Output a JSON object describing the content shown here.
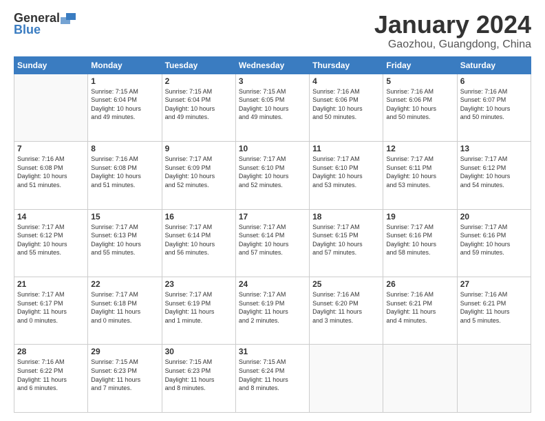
{
  "header": {
    "logo_general": "General",
    "logo_blue": "Blue",
    "month_title": "January 2024",
    "location": "Gaozhou, Guangdong, China"
  },
  "weekdays": [
    "Sunday",
    "Monday",
    "Tuesday",
    "Wednesday",
    "Thursday",
    "Friday",
    "Saturday"
  ],
  "weeks": [
    [
      {
        "day": "",
        "info": ""
      },
      {
        "day": "1",
        "info": "Sunrise: 7:15 AM\nSunset: 6:04 PM\nDaylight: 10 hours\nand 49 minutes."
      },
      {
        "day": "2",
        "info": "Sunrise: 7:15 AM\nSunset: 6:04 PM\nDaylight: 10 hours\nand 49 minutes."
      },
      {
        "day": "3",
        "info": "Sunrise: 7:15 AM\nSunset: 6:05 PM\nDaylight: 10 hours\nand 49 minutes."
      },
      {
        "day": "4",
        "info": "Sunrise: 7:16 AM\nSunset: 6:06 PM\nDaylight: 10 hours\nand 50 minutes."
      },
      {
        "day": "5",
        "info": "Sunrise: 7:16 AM\nSunset: 6:06 PM\nDaylight: 10 hours\nand 50 minutes."
      },
      {
        "day": "6",
        "info": "Sunrise: 7:16 AM\nSunset: 6:07 PM\nDaylight: 10 hours\nand 50 minutes."
      }
    ],
    [
      {
        "day": "7",
        "info": "Sunrise: 7:16 AM\nSunset: 6:08 PM\nDaylight: 10 hours\nand 51 minutes."
      },
      {
        "day": "8",
        "info": "Sunrise: 7:16 AM\nSunset: 6:08 PM\nDaylight: 10 hours\nand 51 minutes."
      },
      {
        "day": "9",
        "info": "Sunrise: 7:17 AM\nSunset: 6:09 PM\nDaylight: 10 hours\nand 52 minutes."
      },
      {
        "day": "10",
        "info": "Sunrise: 7:17 AM\nSunset: 6:10 PM\nDaylight: 10 hours\nand 52 minutes."
      },
      {
        "day": "11",
        "info": "Sunrise: 7:17 AM\nSunset: 6:10 PM\nDaylight: 10 hours\nand 53 minutes."
      },
      {
        "day": "12",
        "info": "Sunrise: 7:17 AM\nSunset: 6:11 PM\nDaylight: 10 hours\nand 53 minutes."
      },
      {
        "day": "13",
        "info": "Sunrise: 7:17 AM\nSunset: 6:12 PM\nDaylight: 10 hours\nand 54 minutes."
      }
    ],
    [
      {
        "day": "14",
        "info": "Sunrise: 7:17 AM\nSunset: 6:12 PM\nDaylight: 10 hours\nand 55 minutes."
      },
      {
        "day": "15",
        "info": "Sunrise: 7:17 AM\nSunset: 6:13 PM\nDaylight: 10 hours\nand 55 minutes."
      },
      {
        "day": "16",
        "info": "Sunrise: 7:17 AM\nSunset: 6:14 PM\nDaylight: 10 hours\nand 56 minutes."
      },
      {
        "day": "17",
        "info": "Sunrise: 7:17 AM\nSunset: 6:14 PM\nDaylight: 10 hours\nand 57 minutes."
      },
      {
        "day": "18",
        "info": "Sunrise: 7:17 AM\nSunset: 6:15 PM\nDaylight: 10 hours\nand 57 minutes."
      },
      {
        "day": "19",
        "info": "Sunrise: 7:17 AM\nSunset: 6:16 PM\nDaylight: 10 hours\nand 58 minutes."
      },
      {
        "day": "20",
        "info": "Sunrise: 7:17 AM\nSunset: 6:16 PM\nDaylight: 10 hours\nand 59 minutes."
      }
    ],
    [
      {
        "day": "21",
        "info": "Sunrise: 7:17 AM\nSunset: 6:17 PM\nDaylight: 11 hours\nand 0 minutes."
      },
      {
        "day": "22",
        "info": "Sunrise: 7:17 AM\nSunset: 6:18 PM\nDaylight: 11 hours\nand 0 minutes."
      },
      {
        "day": "23",
        "info": "Sunrise: 7:17 AM\nSunset: 6:19 PM\nDaylight: 11 hours\nand 1 minute."
      },
      {
        "day": "24",
        "info": "Sunrise: 7:17 AM\nSunset: 6:19 PM\nDaylight: 11 hours\nand 2 minutes."
      },
      {
        "day": "25",
        "info": "Sunrise: 7:16 AM\nSunset: 6:20 PM\nDaylight: 11 hours\nand 3 minutes."
      },
      {
        "day": "26",
        "info": "Sunrise: 7:16 AM\nSunset: 6:21 PM\nDaylight: 11 hours\nand 4 minutes."
      },
      {
        "day": "27",
        "info": "Sunrise: 7:16 AM\nSunset: 6:21 PM\nDaylight: 11 hours\nand 5 minutes."
      }
    ],
    [
      {
        "day": "28",
        "info": "Sunrise: 7:16 AM\nSunset: 6:22 PM\nDaylight: 11 hours\nand 6 minutes."
      },
      {
        "day": "29",
        "info": "Sunrise: 7:15 AM\nSunset: 6:23 PM\nDaylight: 11 hours\nand 7 minutes."
      },
      {
        "day": "30",
        "info": "Sunrise: 7:15 AM\nSunset: 6:23 PM\nDaylight: 11 hours\nand 8 minutes."
      },
      {
        "day": "31",
        "info": "Sunrise: 7:15 AM\nSunset: 6:24 PM\nDaylight: 11 hours\nand 8 minutes."
      },
      {
        "day": "",
        "info": ""
      },
      {
        "day": "",
        "info": ""
      },
      {
        "day": "",
        "info": ""
      }
    ]
  ]
}
